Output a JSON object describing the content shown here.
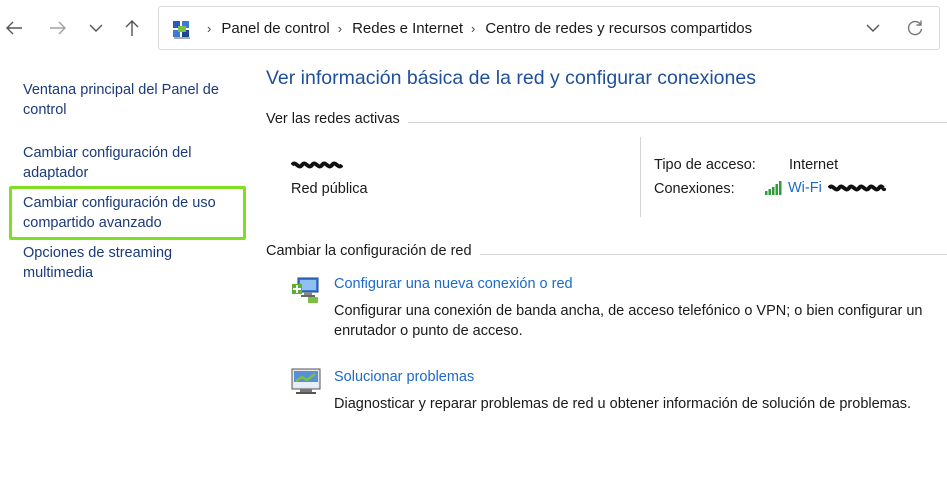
{
  "nav": {
    "back_icon": "arrow-left-icon",
    "forward_icon": "arrow-right-icon",
    "recent_icon": "chevron-down-icon",
    "up_icon": "arrow-up-icon"
  },
  "address_bar": {
    "icon": "control-panel-icon",
    "breadcrumbs": [
      "Panel de control",
      "Redes e Internet",
      "Centro de redes y recursos compartidos"
    ],
    "dropdown_icon": "chevron-down-icon",
    "refresh_icon": "refresh-icon"
  },
  "sidebar": {
    "items": [
      {
        "label": "Ventana principal del Panel de control"
      },
      {
        "label": "Cambiar configuración del adaptador"
      },
      {
        "label": "Cambiar configuración de uso compartido avanzado",
        "highlighted": true
      },
      {
        "label": "Opciones de streaming multimedia"
      }
    ],
    "highlight_color": "#7fe022"
  },
  "main": {
    "title": "Ver información básica de la red y configurar conexiones",
    "active_networks_heading": "Ver las redes activas",
    "network": {
      "name_redacted": true,
      "type": "Red pública",
      "access_type_label": "Tipo de acceso:",
      "access_type_value": "Internet",
      "connections_label": "Conexiones:",
      "connection_link": "Wi-Fi",
      "connection_icon": "wifi-signal-icon"
    },
    "change_settings_heading": "Cambiar la configuración de red",
    "tasks": [
      {
        "icon": "new-connection-icon",
        "link": "Configurar una nueva conexión o red",
        "description": "Configurar una conexión de banda ancha, de acceso telefónico o VPN; o bien configurar un enrutador o punto de acceso."
      },
      {
        "icon": "troubleshoot-icon",
        "link": "Solucionar problemas",
        "description": "Diagnosticar y reparar problemas de red u obtener información de solución de problemas."
      }
    ]
  },
  "colors": {
    "title_blue": "#1e4f9c",
    "link_blue": "#1b6ac9",
    "sidebar_link": "#1b3a7a",
    "highlight_green": "#7fe022"
  }
}
